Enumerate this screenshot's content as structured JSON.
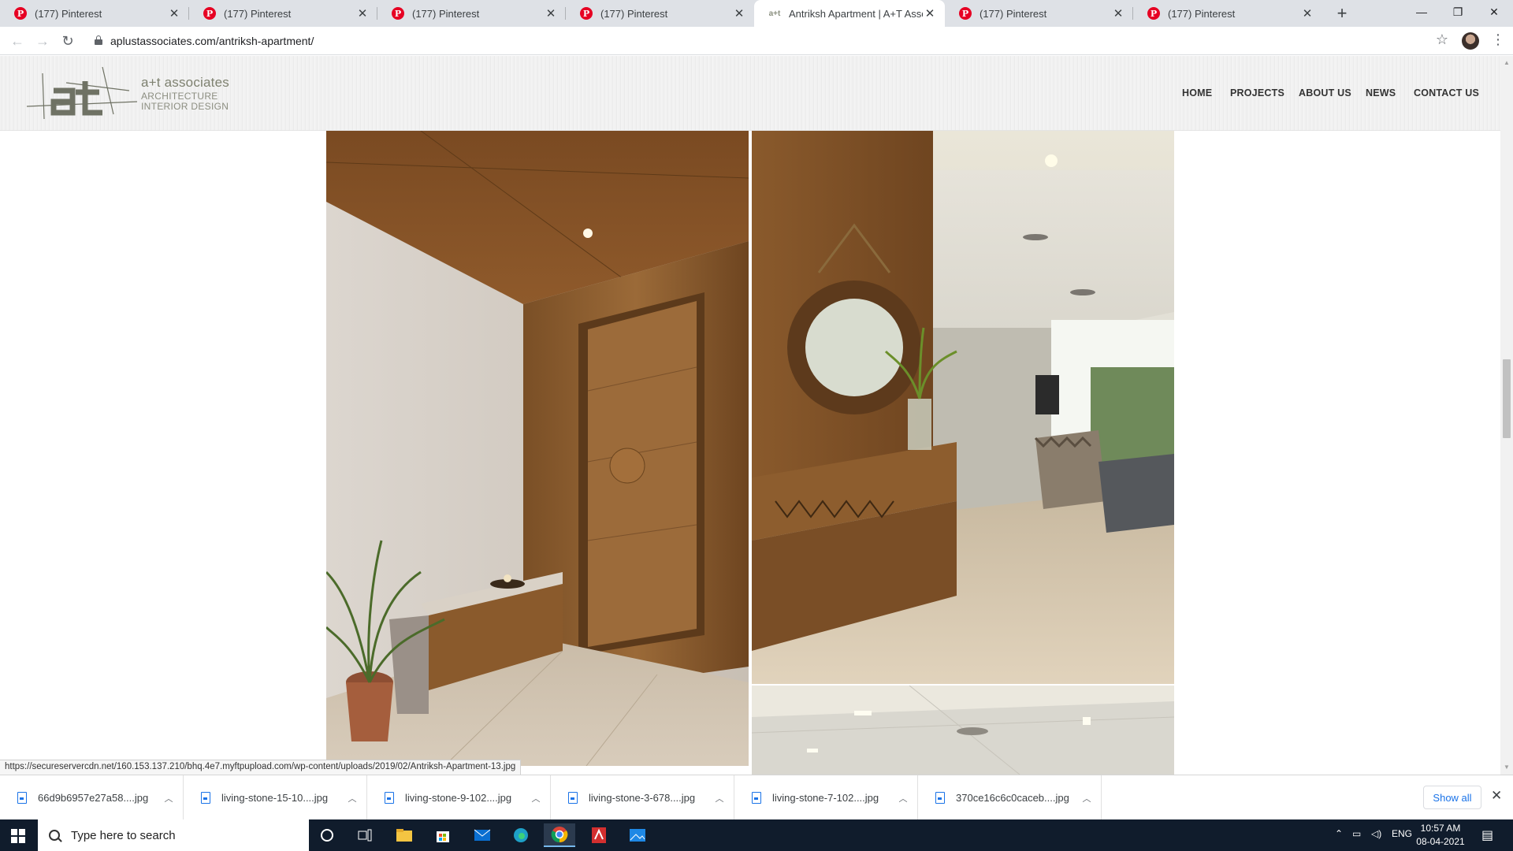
{
  "browser": {
    "tabs": [
      {
        "title": "(177) Pinterest",
        "favicon": "pinterest-icon",
        "active": false
      },
      {
        "title": "(177) Pinterest",
        "favicon": "pinterest-icon",
        "active": false
      },
      {
        "title": "(177) Pinterest",
        "favicon": "pinterest-icon",
        "active": false
      },
      {
        "title": "(177) Pinterest",
        "favicon": "pinterest-icon",
        "active": false
      },
      {
        "title": "Antriksh Apartment | A+T Associ",
        "favicon": "site-icon",
        "favicon_text": "a+t",
        "active": true
      },
      {
        "title": "(177) Pinterest",
        "favicon": "pinterest-icon",
        "active": false
      },
      {
        "title": "(177) Pinterest",
        "favicon": "pinterest-icon",
        "active": false
      }
    ],
    "url": "aplustassociates.com/antriksh-apartment/",
    "status_url": "https://secureservercdn.net/160.153.137.210/bhq.4e7.myftpupload.com/wp-content/uploads/2019/02/Antriksh-Apartment-13.jpg"
  },
  "site": {
    "logo": {
      "brand": "a+t associates",
      "line1": "ARCHITECTURE",
      "line2": "INTERIOR DESIGN"
    },
    "nav": [
      "HOME",
      "PROJECTS",
      "ABOUT US",
      "NEWS",
      "CONTACT US"
    ]
  },
  "gallery": [
    {
      "name": "entrance-door-photo"
    },
    {
      "name": "mirror-console-living-photo"
    },
    {
      "name": "living-ceiling-photo"
    }
  ],
  "downloads": {
    "items": [
      "66d9b6957e27a58....jpg",
      "living-stone-15-10....jpg",
      "living-stone-9-102....jpg",
      "living-stone-3-678....jpg",
      "living-stone-7-102....jpg",
      "370ce16c6c0caceb....jpg"
    ],
    "show_all": "Show all"
  },
  "taskbar": {
    "search_placeholder": "Type here to search",
    "language": "ENG",
    "time": "10:57 AM",
    "date": "08-04-2021"
  },
  "colors": {
    "pinterest": "#e60023",
    "link_blue": "#1a73e8",
    "taskbar": "#101c2c"
  }
}
